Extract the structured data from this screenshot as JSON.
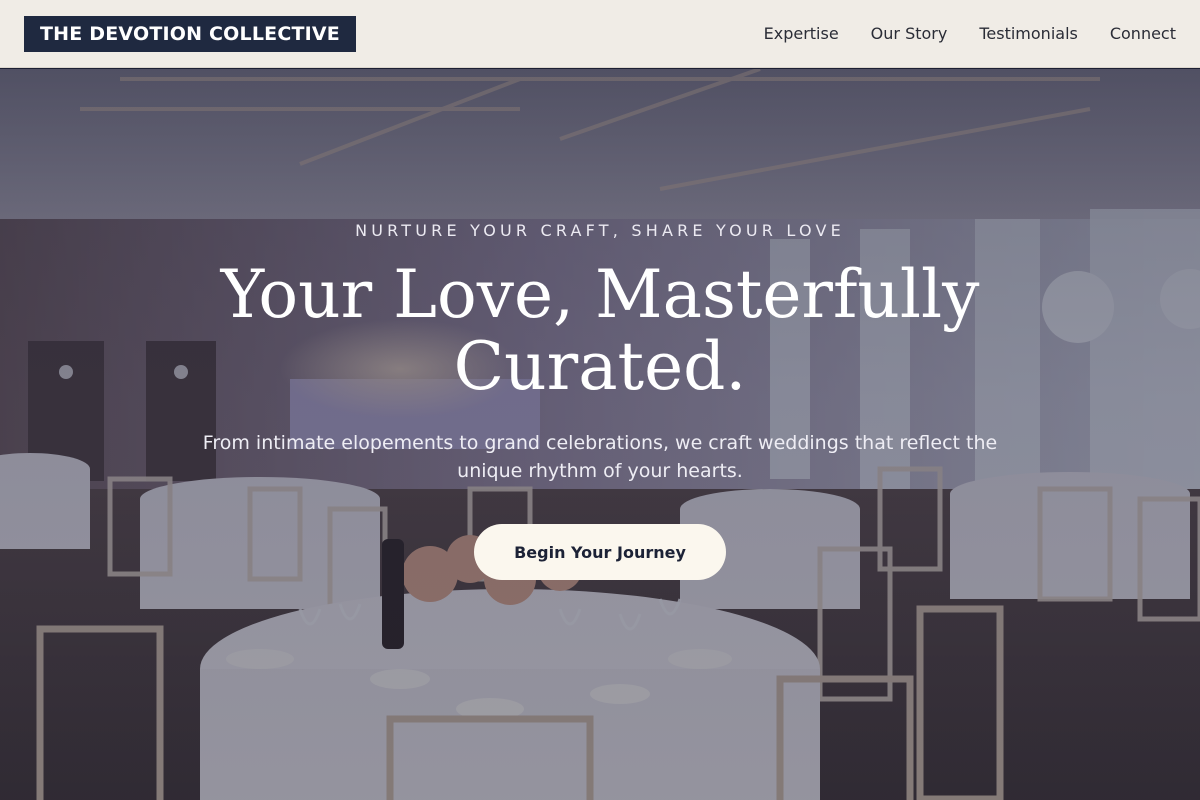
{
  "brand": {
    "logo_text": "THE DEVOTION COLLECTIVE"
  },
  "nav": {
    "items": [
      {
        "label": "Expertise"
      },
      {
        "label": "Our Story"
      },
      {
        "label": "Testimonials"
      },
      {
        "label": "Connect"
      }
    ]
  },
  "hero": {
    "eyebrow": "NURTURE YOUR CRAFT, SHARE YOUR LOVE",
    "headline": "Your Love, Masterfully Curated.",
    "subtitle": "From intimate elopements to grand celebrations, we craft weddings that reflect the unique rhythm of your hearts.",
    "cta_label": "Begin Your Journey"
  },
  "colors": {
    "header_bg": "#f0ece6",
    "logo_bg": "#1f2940",
    "cta_bg": "#fbf7ee",
    "overlay": "#1c1e34"
  }
}
